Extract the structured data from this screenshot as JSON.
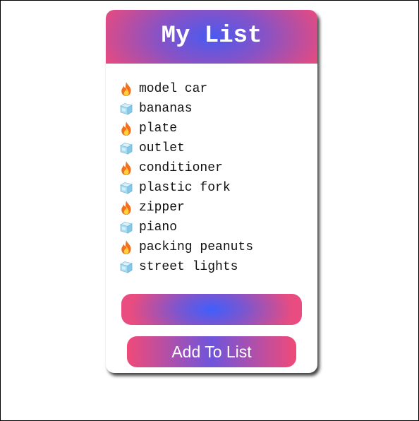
{
  "header": {
    "title": "My List"
  },
  "list": {
    "items": [
      {
        "label": "model car",
        "icon": "fire-icon"
      },
      {
        "label": "bananas",
        "icon": "ice-cube-icon"
      },
      {
        "label": "plate",
        "icon": "fire-icon"
      },
      {
        "label": "outlet",
        "icon": "ice-cube-icon"
      },
      {
        "label": "conditioner",
        "icon": "fire-icon"
      },
      {
        "label": "plastic fork",
        "icon": "ice-cube-icon"
      },
      {
        "label": "zipper",
        "icon": "fire-icon"
      },
      {
        "label": "piano",
        "icon": "ice-cube-icon"
      },
      {
        "label": "packing peanuts",
        "icon": "fire-icon"
      },
      {
        "label": "street lights",
        "icon": "ice-cube-icon"
      }
    ]
  },
  "input": {
    "value": "",
    "placeholder": ""
  },
  "actions": {
    "add_label": "Add To List"
  },
  "colors": {
    "accent_pink": "#f04a78",
    "accent_blue": "#4a5af0",
    "text": "#111111"
  }
}
